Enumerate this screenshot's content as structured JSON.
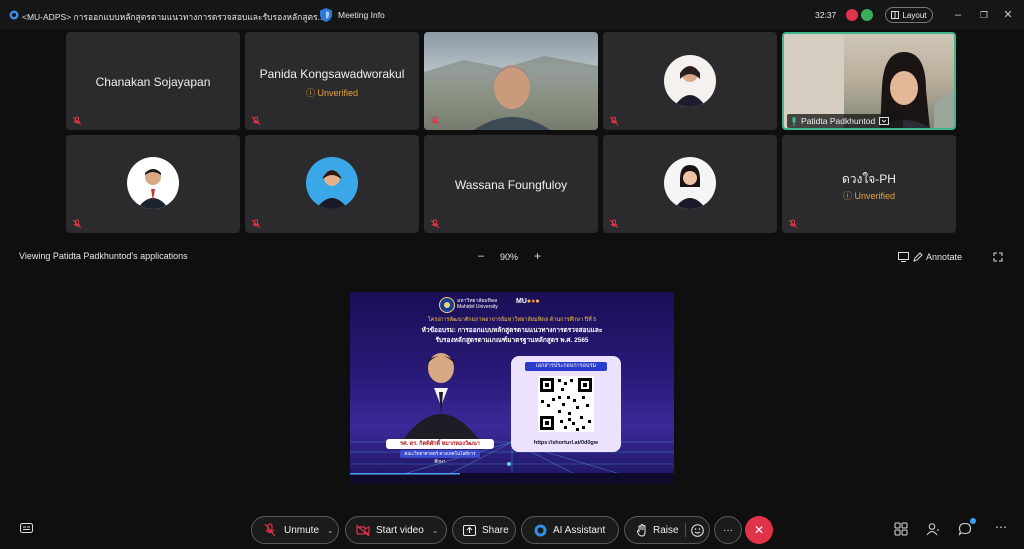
{
  "window": {
    "title": "<MU-ADPS> การออกแบบหลักสูตรตามแนวทางการตรวจสอบและรับรองหลักสูตร...",
    "meeting_info": "Meeting Info",
    "timer": "32:37",
    "layout_label": "Layout"
  },
  "participants": [
    {
      "name": "Chanakan Sojayapan",
      "unverified": ""
    },
    {
      "name": "Panida Kongsawadworakul",
      "unverified": "Unverified"
    },
    {
      "name": "",
      "unverified": ""
    },
    {
      "name": "",
      "unverified": ""
    },
    {
      "name": "Patidta Padkhuntod",
      "unverified": ""
    },
    {
      "name": "",
      "unverified": ""
    },
    {
      "name": "",
      "unverified": ""
    },
    {
      "name": "Wassana Foungfuloy",
      "unverified": ""
    },
    {
      "name": "",
      "unverified": ""
    },
    {
      "name": "ดวงใจ-PH",
      "unverified": "Unverified"
    }
  ],
  "share_bar": {
    "viewing": "Viewing Patidta Padkhuntod's applications",
    "zoom": "90%",
    "annotate": "Annotate"
  },
  "slide": {
    "uni_name_th": "มหาวิทยาลัยมหิดล",
    "uni_name_en": "Mahidol University",
    "program": "โครงการพัฒนาศักยภาพอาจารย์มหาวิทยาลัยมหิดล ด้านการศึกษา ปีที่ 5",
    "topic_line1": "หัวข้ออบรม: การออกแบบหลักสูตรตามแนวทางการตรวจสอบและ",
    "topic_line2": "รับรองหลักสูตรตามเกณฑ์มาตรฐานหลักสูตร พ.ศ. 2565",
    "qr_title": "เอกสารประกอบการอบรม",
    "url": "https://shorturl.at/0d0gw",
    "speaker": "รศ. ดร. กิตติศักดิ์ หมากทองวัฒนา",
    "speaker_role": "คณะวิทยาศาสตร์ ควงเทคโนโลยีการศึกษา"
  },
  "controls": {
    "unmute": "Unmute",
    "start_video": "Start video",
    "share": "Share",
    "ai_assistant": "AI Assistant",
    "raise": "Raise",
    "more": "···"
  },
  "colors": {
    "tile_bg": "#2b2b2d",
    "unverified": "#e6a23c",
    "end_call": "#e0334a",
    "active_border": "#3fb68b"
  }
}
